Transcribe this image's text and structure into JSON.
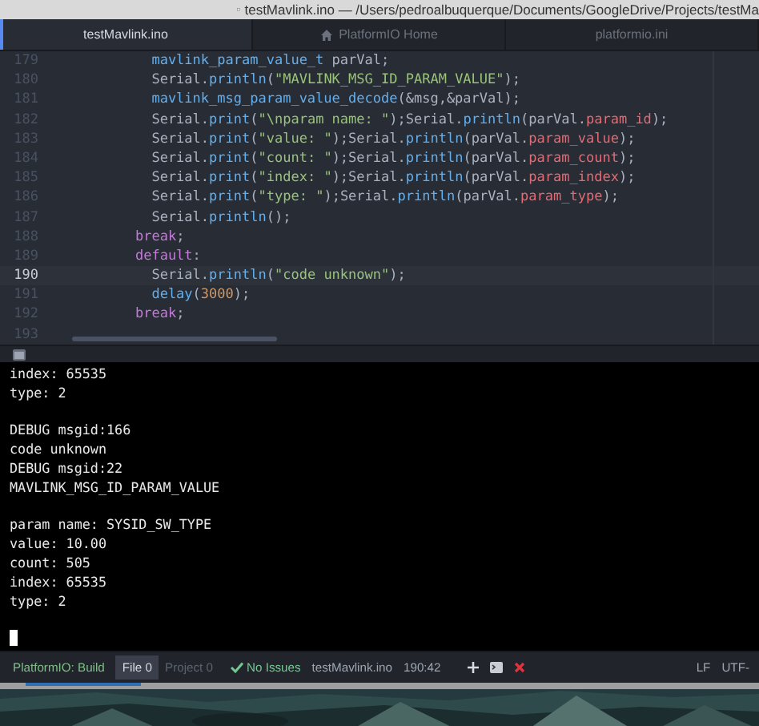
{
  "window": {
    "title": "testMavlink.ino — /Users/pedroalbuquerque/Documents/GoogleDrive/Projects/testMa"
  },
  "tabs": [
    {
      "label": "testMavlink.ino",
      "selected": true,
      "kind": "file"
    },
    {
      "label": "PlatformIO Home",
      "selected": false,
      "kind": "home"
    },
    {
      "label": "platformio.ini",
      "selected": false,
      "kind": "file"
    }
  ],
  "editor": {
    "lines": [
      {
        "number": "179",
        "current": false,
        "tokens": [
          {
            "kind": "type",
            "text": "      mavlink_param_value_t"
          },
          {
            "kind": "plain",
            "text": " parVal;"
          }
        ]
      },
      {
        "number": "180",
        "current": false,
        "tokens": [
          {
            "kind": "plain",
            "text": "      Serial."
          },
          {
            "kind": "fn",
            "text": "println"
          },
          {
            "kind": "plain",
            "text": "("
          },
          {
            "kind": "str",
            "text": "\"MAVLINK_MSG_ID_PARAM_VALUE\""
          },
          {
            "kind": "plain",
            "text": ");"
          }
        ]
      },
      {
        "number": "181",
        "current": false,
        "tokens": [
          {
            "kind": "fn",
            "text": "      mavlink_msg_param_value_decode"
          },
          {
            "kind": "plain",
            "text": "(&msg,&parVal);"
          }
        ]
      },
      {
        "number": "182",
        "current": false,
        "tokens": [
          {
            "kind": "plain",
            "text": "      Serial."
          },
          {
            "kind": "fn",
            "text": "print"
          },
          {
            "kind": "plain",
            "text": "("
          },
          {
            "kind": "str",
            "text": "\"\\nparam name: \""
          },
          {
            "kind": "plain",
            "text": ");Serial."
          },
          {
            "kind": "fn",
            "text": "println"
          },
          {
            "kind": "plain",
            "text": "(parVal."
          },
          {
            "kind": "prop",
            "text": "param_id"
          },
          {
            "kind": "plain",
            "text": ");"
          }
        ]
      },
      {
        "number": "183",
        "current": false,
        "tokens": [
          {
            "kind": "plain",
            "text": "      Serial."
          },
          {
            "kind": "fn",
            "text": "print"
          },
          {
            "kind": "plain",
            "text": "("
          },
          {
            "kind": "str",
            "text": "\"value: \""
          },
          {
            "kind": "plain",
            "text": ");Serial."
          },
          {
            "kind": "fn",
            "text": "println"
          },
          {
            "kind": "plain",
            "text": "(parVal."
          },
          {
            "kind": "prop",
            "text": "param_value"
          },
          {
            "kind": "plain",
            "text": ");"
          }
        ]
      },
      {
        "number": "184",
        "current": false,
        "tokens": [
          {
            "kind": "plain",
            "text": "      Serial."
          },
          {
            "kind": "fn",
            "text": "print"
          },
          {
            "kind": "plain",
            "text": "("
          },
          {
            "kind": "str",
            "text": "\"count: \""
          },
          {
            "kind": "plain",
            "text": ");Serial."
          },
          {
            "kind": "fn",
            "text": "println"
          },
          {
            "kind": "plain",
            "text": "(parVal."
          },
          {
            "kind": "prop",
            "text": "param_count"
          },
          {
            "kind": "plain",
            "text": ");"
          }
        ]
      },
      {
        "number": "185",
        "current": false,
        "tokens": [
          {
            "kind": "plain",
            "text": "      Serial."
          },
          {
            "kind": "fn",
            "text": "print"
          },
          {
            "kind": "plain",
            "text": "("
          },
          {
            "kind": "str",
            "text": "\"index: \""
          },
          {
            "kind": "plain",
            "text": ");Serial."
          },
          {
            "kind": "fn",
            "text": "println"
          },
          {
            "kind": "plain",
            "text": "(parVal."
          },
          {
            "kind": "prop",
            "text": "param_index"
          },
          {
            "kind": "plain",
            "text": ");"
          }
        ]
      },
      {
        "number": "186",
        "current": false,
        "tokens": [
          {
            "kind": "plain",
            "text": "      Serial."
          },
          {
            "kind": "fn",
            "text": "print"
          },
          {
            "kind": "plain",
            "text": "("
          },
          {
            "kind": "str",
            "text": "\"type: \""
          },
          {
            "kind": "plain",
            "text": ");Serial."
          },
          {
            "kind": "fn",
            "text": "println"
          },
          {
            "kind": "plain",
            "text": "(parVal."
          },
          {
            "kind": "prop",
            "text": "param_type"
          },
          {
            "kind": "plain",
            "text": ");"
          }
        ]
      },
      {
        "number": "187",
        "current": false,
        "tokens": [
          {
            "kind": "plain",
            "text": "      Serial."
          },
          {
            "kind": "fn",
            "text": "println"
          },
          {
            "kind": "plain",
            "text": "();"
          }
        ]
      },
      {
        "number": "188",
        "current": false,
        "tokens": [
          {
            "kind": "kw",
            "text": "    break"
          },
          {
            "kind": "plain",
            "text": ";"
          }
        ]
      },
      {
        "number": "189",
        "current": false,
        "tokens": [
          {
            "kind": "kw",
            "text": "    default"
          },
          {
            "kind": "plain",
            "text": ":"
          }
        ]
      },
      {
        "number": "190",
        "current": true,
        "tokens": [
          {
            "kind": "plain",
            "text": "      Serial."
          },
          {
            "kind": "fn",
            "text": "println"
          },
          {
            "kind": "plain",
            "text": "("
          },
          {
            "kind": "str",
            "text": "\"code unknown\""
          },
          {
            "kind": "plain",
            "text": ");"
          }
        ]
      },
      {
        "number": "191",
        "current": false,
        "tokens": [
          {
            "kind": "fn",
            "text": "      delay"
          },
          {
            "kind": "plain",
            "text": "("
          },
          {
            "kind": "num",
            "text": "3000"
          },
          {
            "kind": "plain",
            "text": ");"
          }
        ]
      },
      {
        "number": "192",
        "current": false,
        "tokens": [
          {
            "kind": "kw",
            "text": "    break"
          },
          {
            "kind": "plain",
            "text": ";"
          }
        ]
      },
      {
        "number": "193",
        "current": false
      }
    ]
  },
  "terminal": {
    "blocks": [
      [
        "index: 65535",
        "type: 2"
      ],
      [
        "DEBUG msgid:166",
        "code unknown",
        "DEBUG msgid:22",
        "MAVLINK_MSG_ID_PARAM_VALUE"
      ],
      [
        "param name: SYSID_SW_TYPE",
        "value: 10.00",
        "count: 505",
        "index: 65535",
        "type: 2"
      ]
    ]
  },
  "status_bar": {
    "build": "PlatformIO: Build",
    "scopes": [
      {
        "label": "File",
        "count": "0",
        "selected": true
      },
      {
        "label": "Project",
        "count": "0",
        "selected": false
      }
    ],
    "issues": "No Issues",
    "file": "testMavlink.ino",
    "position": "190:42",
    "line_ending": "LF",
    "encoding": "UTF-"
  }
}
